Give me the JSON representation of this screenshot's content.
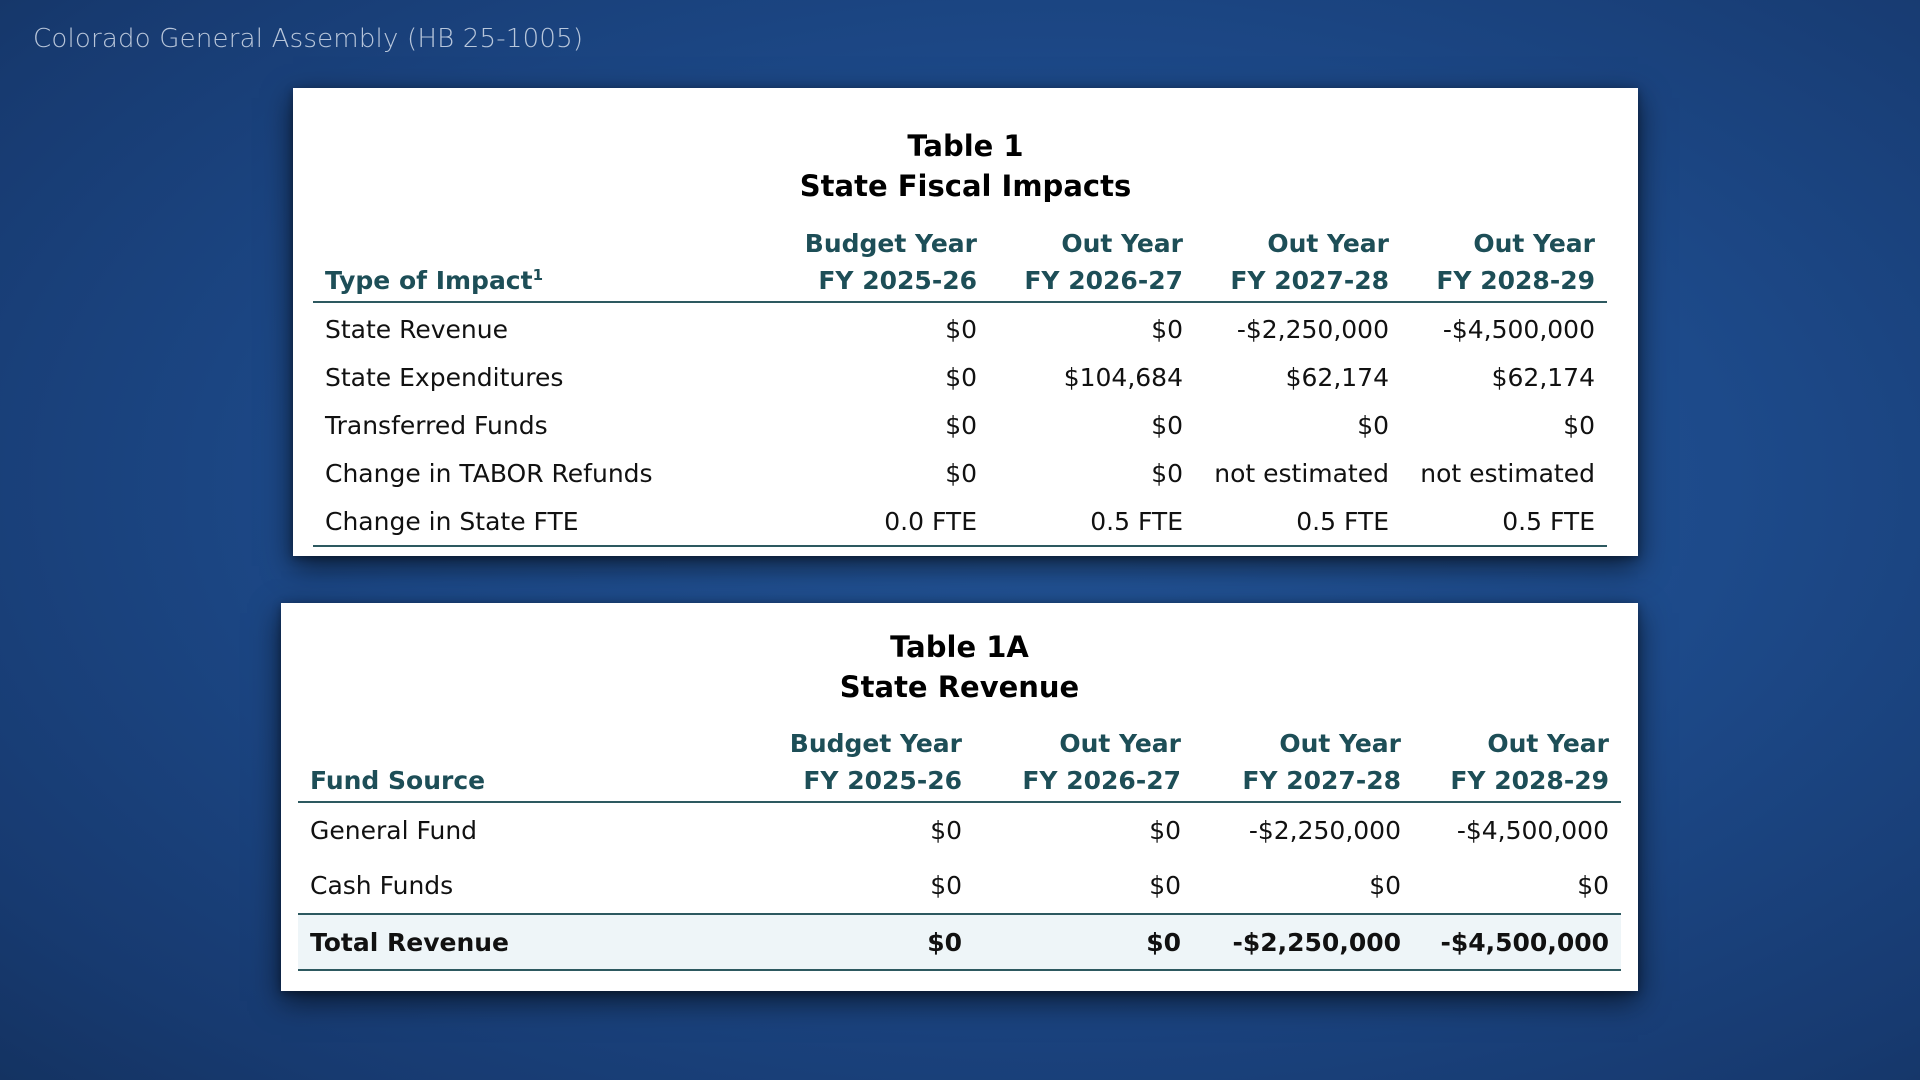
{
  "source": "Colorado General Assembly (HB 25-1005)",
  "table1": {
    "title_line1": "Table 1",
    "title_line2": "State Fiscal Impacts",
    "header_first": "Type of Impact",
    "header_first_footnote": "1",
    "columns": [
      {
        "line1": "Budget Year",
        "line2": "FY 2025-26"
      },
      {
        "line1": "Out Year",
        "line2": "FY 2026-27"
      },
      {
        "line1": "Out Year",
        "line2": "FY 2027-28"
      },
      {
        "line1": "Out Year",
        "line2": "FY 2028-29"
      }
    ],
    "rows": [
      {
        "label": "State Revenue",
        "values": [
          "$0",
          "$0",
          "-$2,250,000",
          "-$4,500,000"
        ]
      },
      {
        "label": "State Expenditures",
        "values": [
          "$0",
          "$104,684",
          "$62,174",
          "$62,174"
        ]
      },
      {
        "label": "Transferred Funds",
        "values": [
          "$0",
          "$0",
          "$0",
          "$0"
        ]
      },
      {
        "label": "Change in TABOR Refunds",
        "values": [
          "$0",
          "$0",
          "not estimated",
          "not estimated"
        ]
      },
      {
        "label": "Change in State FTE",
        "values": [
          "0.0 FTE",
          "0.5 FTE",
          "0.5 FTE",
          "0.5 FTE"
        ]
      }
    ]
  },
  "table2": {
    "title_line1": "Table 1A",
    "title_line2": "State Revenue",
    "header_first": "Fund Source",
    "columns": [
      {
        "line1": "Budget Year",
        "line2": "FY 2025-26"
      },
      {
        "line1": "Out Year",
        "line2": "FY 2026-27"
      },
      {
        "line1": "Out Year",
        "line2": "FY 2027-28"
      },
      {
        "line1": "Out Year",
        "line2": "FY 2028-29"
      }
    ],
    "rows": [
      {
        "label": "General Fund",
        "values": [
          "$0",
          "$0",
          "-$2,250,000",
          "-$4,500,000"
        ]
      },
      {
        "label": "Cash Funds",
        "values": [
          "$0",
          "$0",
          "$0",
          "$0"
        ]
      }
    ],
    "total": {
      "label": "Total Revenue",
      "values": [
        "$0",
        "$0",
        "-$2,250,000",
        "-$4,500,000"
      ]
    }
  },
  "colors": {
    "header_text": "#1d4e57",
    "rule": "#2d5960",
    "total_row_bg": "#eef5f8",
    "background": "#1d4a8a"
  }
}
